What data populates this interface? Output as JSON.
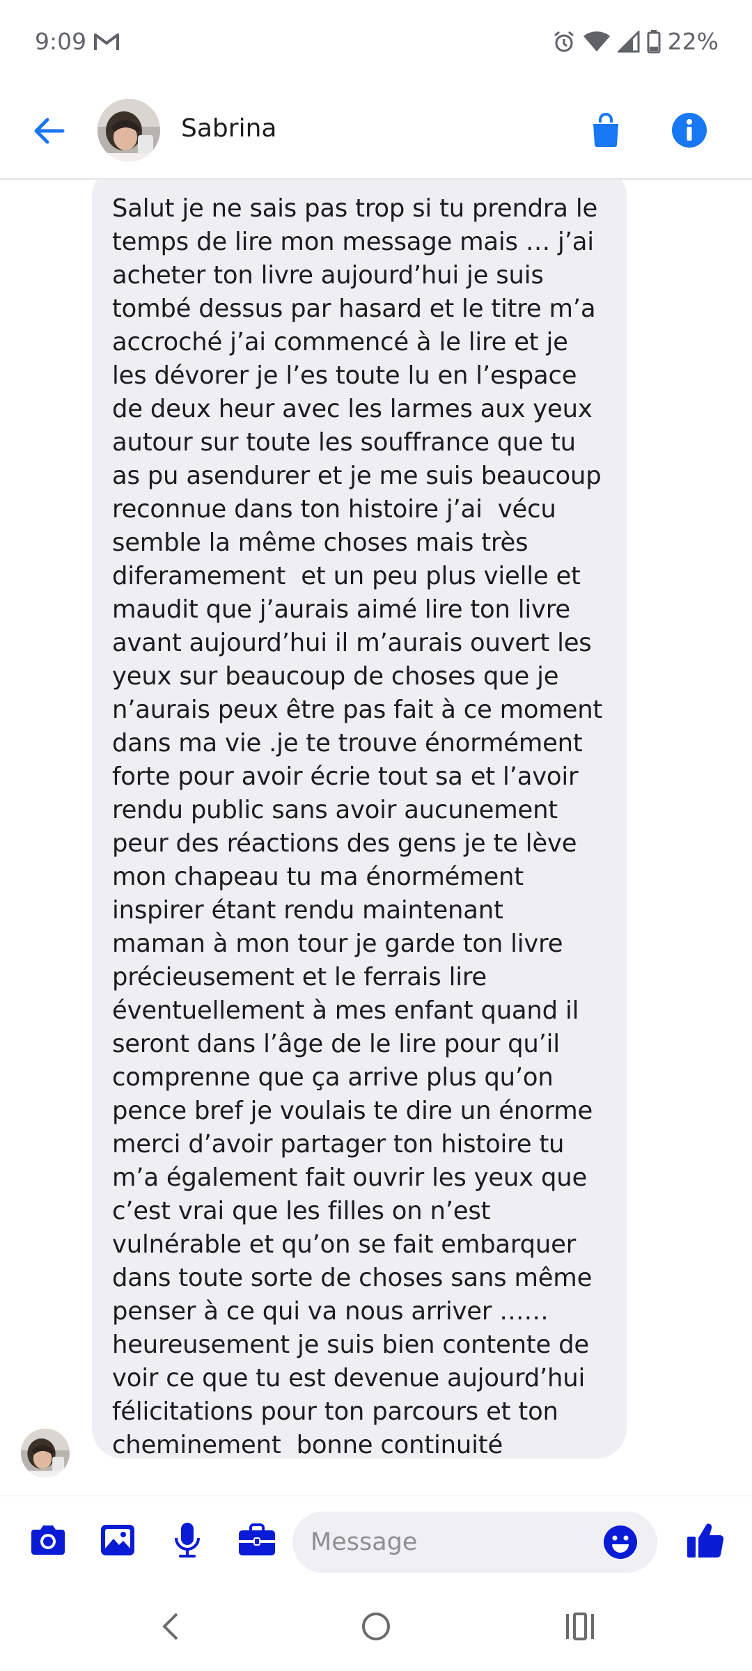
{
  "status_bar": {
    "time": "9:09",
    "battery": "22%",
    "icons": [
      "gmail-icon",
      "alarm-icon",
      "wifi-icon",
      "signal-icon",
      "battery-icon"
    ]
  },
  "header": {
    "contact_name": "Sabrina",
    "icons": [
      "back-arrow-icon",
      "shopping-bag-icon",
      "info-icon"
    ],
    "accent_color": "#1877f2"
  },
  "conversation": {
    "messages": [
      {
        "sender": "Sabrina",
        "text": "Salut je ne sais pas trop si tu prendra le\ntemps de lire mon message mais … j’ai\nacheter ton livre aujourd’hui je suis\ntombé dessus par hasard et le titre m’a\naccroché j’ai commencé à le lire et je\nles dévorer je l’es toute lu en l’espace\nde deux heur avec les larmes aux yeux\nautour sur toute les souffrance que tu\nas pu asendurer et je me suis beaucoup\nreconnue dans ton histoire j’ai  vécu\nsemble la même choses mais très\ndiferamement  et un peu plus vielle et\nmaudit que j’aurais aimé lire ton livre\navant aujourd’hui il m’aurais ouvert les\nyeux sur beaucoup de choses que je\nn’aurais peux être pas fait à ce moment\ndans ma vie .je te trouve énormément\nforte pour avoir écrie tout sa et l’avoir\nrendu public sans avoir aucunement\npeur des réactions des gens je te lève\nmon chapeau tu ma énormément\ninspirer étant rendu maintenant\nmaman à mon tour je garde ton livre\nprécieusement et le ferrais lire\néventuellement à mes enfant quand il\nseront dans l’âge de le lire pour qu’il\ncomprenne que ça arrive plus qu’on\npence bref je voulais te dire un énorme\nmerci d’avoir partager ton histoire tu\nm’a également fait ouvrir les yeux que\nc’est vrai que les filles on n’est\nvulnérable et qu’on se fait embarquer\ndans toute sorte de choses sans même\npenser à ce qui va nous arriver ……\nheureusement je suis bien contente de\nvoir ce que tu est devenue aujourd’hui\nfélicitations pour ton parcours et ton\ncheminement  bonne continuité",
        "bubble_color": "#efeff3"
      }
    ]
  },
  "composer": {
    "placeholder": "Message",
    "icons": [
      "camera-icon",
      "gallery-icon",
      "microphone-icon",
      "briefcase-icon",
      "emoji-icon",
      "thumbs-up-icon"
    ],
    "icon_color": "#0a1bd6"
  },
  "nav_bar": {
    "icons": [
      "back-nav-icon",
      "home-nav-icon",
      "recents-nav-icon"
    ]
  }
}
